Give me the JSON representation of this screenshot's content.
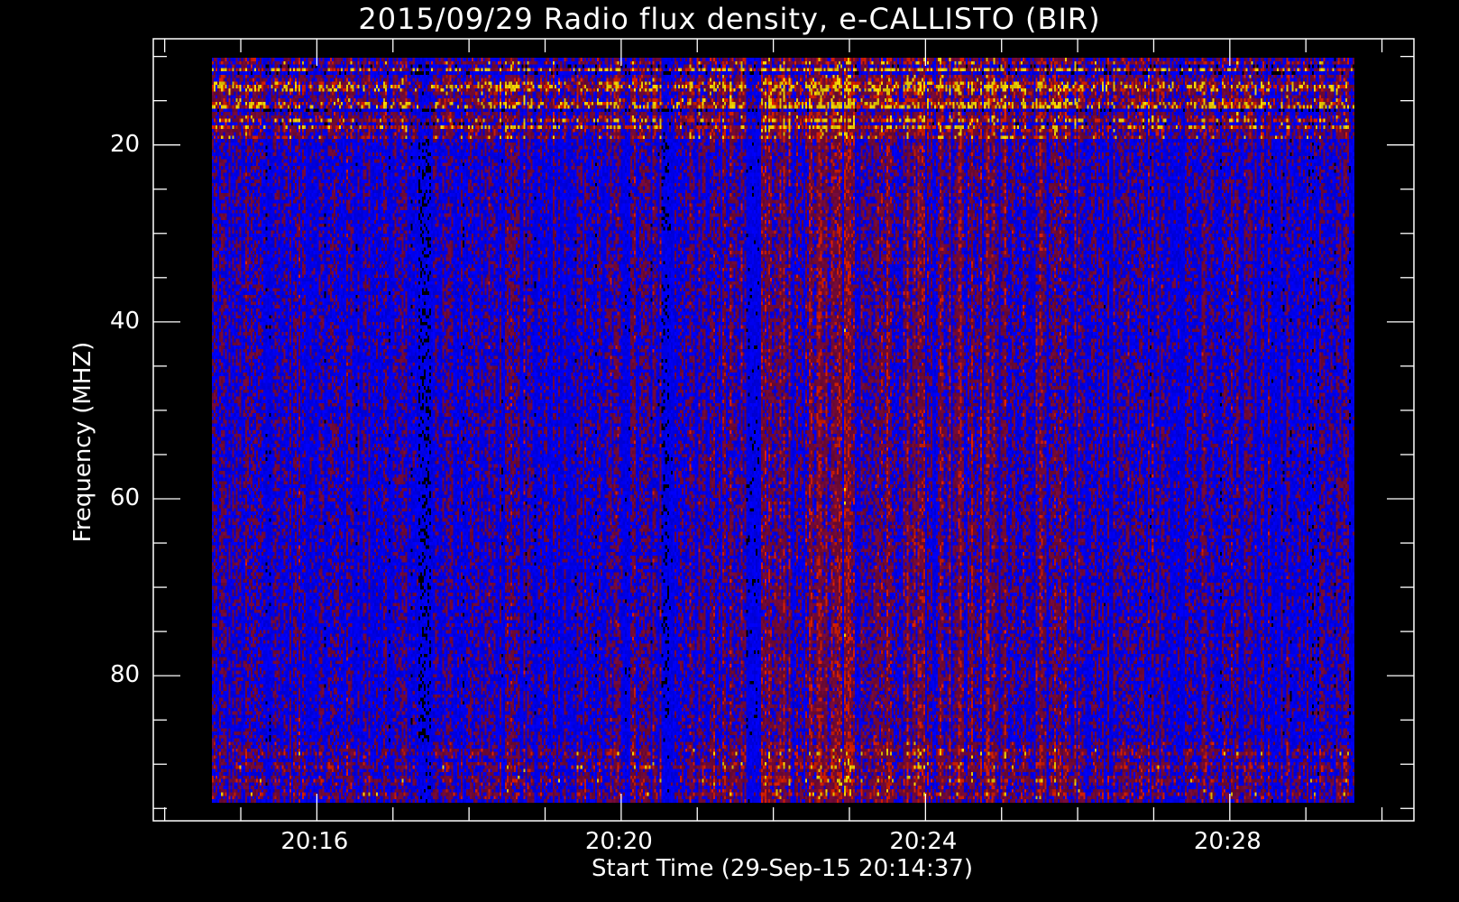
{
  "chart_data": {
    "type": "heatmap",
    "title": "2015/09/29  Radio flux density, e-CALLISTO (BIR)",
    "xlabel": "Start Time (29-Sep-15 20:14:37)",
    "ylabel": "Frequency (MHZ)",
    "x_unit": "minutes since 20:00",
    "xlim": [
      13.85,
      30.42
    ],
    "data_xrange": [
      14.617,
      29.617
    ],
    "xticks": [
      {
        "value": 16,
        "label": "20:16"
      },
      {
        "value": 20,
        "label": "20:20"
      },
      {
        "value": 24,
        "label": "20:24"
      },
      {
        "value": 28,
        "label": "20:28"
      }
    ],
    "x_minor_step": 1,
    "ylim": [
      96.4,
      8
    ],
    "data_yrange": [
      10,
      94.2
    ],
    "yticks": [
      {
        "value": 20,
        "label": "20"
      },
      {
        "value": 40,
        "label": "40"
      },
      {
        "value": 60,
        "label": "60"
      },
      {
        "value": 80,
        "label": "80"
      }
    ],
    "y_minor_step": 5,
    "y_inverted": true,
    "colormap": [
      "#000000",
      "#0000ff",
      "#7a0a3c",
      "#e02000",
      "#ffdc00"
    ],
    "features": {
      "bright_bands_mhz": [
        [
          10,
          19
        ],
        [
          87,
          94
        ]
      ],
      "dark_columns_minutes": [
        17.4,
        20.6,
        21.7
      ]
    }
  }
}
